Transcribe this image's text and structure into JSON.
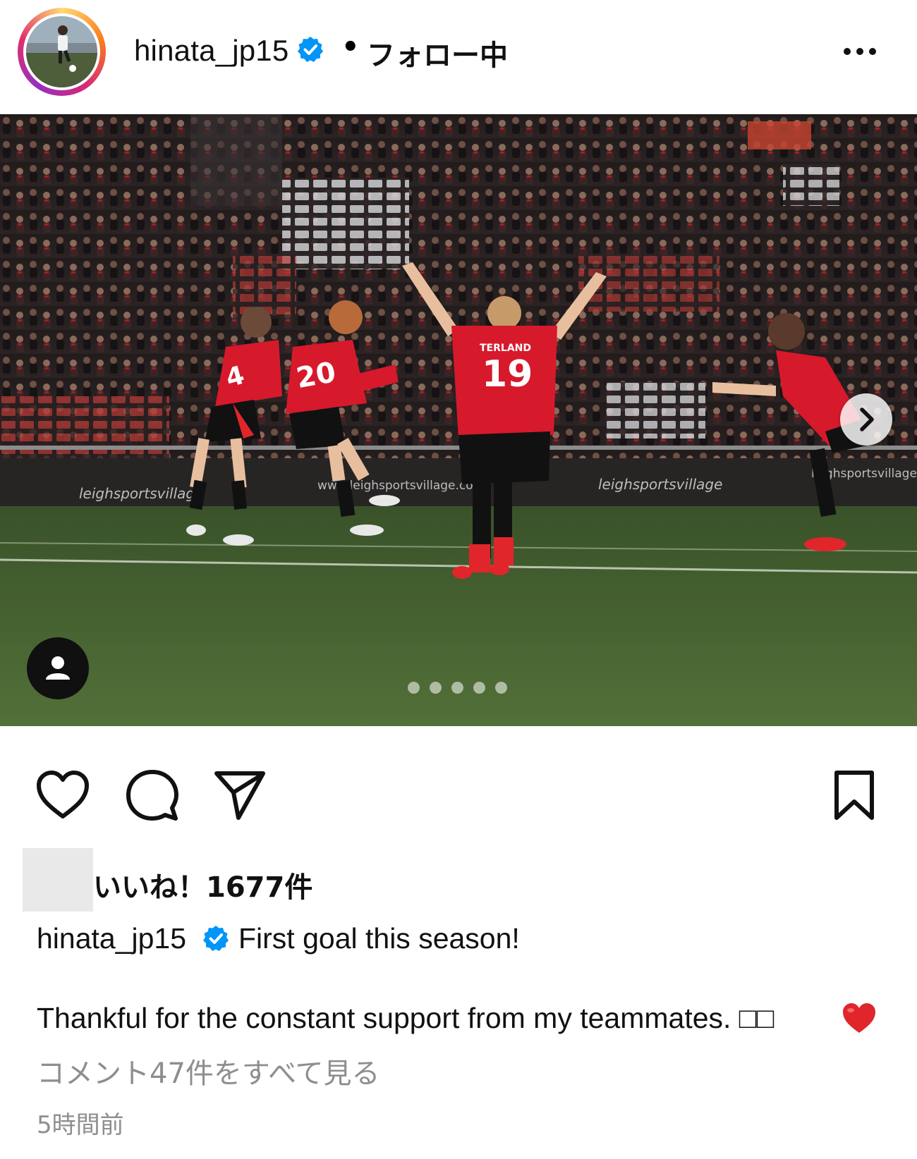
{
  "header": {
    "username": "hinata_jp15",
    "verified_icon": "verified-badge-icon",
    "separator": "•",
    "follow_status": "フォロー中",
    "more_icon": "more-options-icon"
  },
  "post": {
    "image_count": 5,
    "active_image_index": 0,
    "next_icon": "chevron-right-icon",
    "user_tag_icon": "person-icon"
  },
  "actions": {
    "like_icon": "heart-icon",
    "comment_icon": "comment-icon",
    "share_icon": "send-icon",
    "save_icon": "bookmark-icon"
  },
  "likes": {
    "text": "いいね！1677件"
  },
  "caption": {
    "username": "hinata_jp15",
    "first_line": "First goal this season!",
    "body": "Thankful for the constant support from my teammates. □□"
  },
  "comments_link": "コメント47件をすべて見る",
  "timestamp": "5時間前",
  "colors": {
    "verified": "#0095f6",
    "heart_emoji": "#e0262b",
    "muted_text": "#8e8e8e",
    "jersey_red": "#d7192c"
  }
}
